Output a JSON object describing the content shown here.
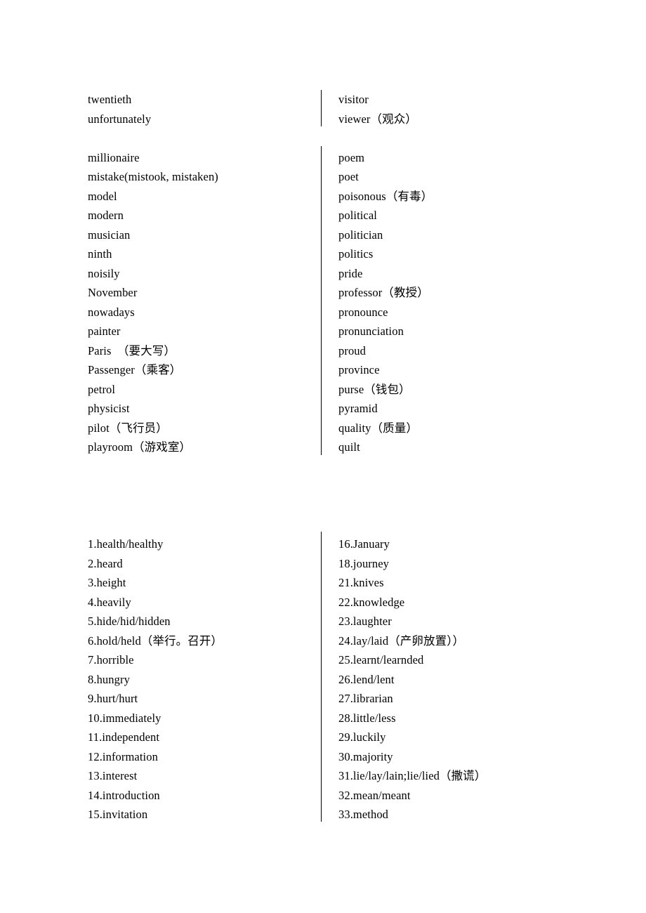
{
  "document": {
    "type": "vocabulary-word-list",
    "sections": [
      {
        "id": "words",
        "numbered": false,
        "left_column": {
          "blocks": [
            {
              "items": [
                "twentieth",
                "unfortunately"
              ]
            },
            {
              "items": [
                "millionaire",
                "mistake(mistook, mistaken)",
                "model",
                "modern",
                "musician",
                "ninth",
                "noisily",
                "November",
                "nowadays",
                "painter",
                "Paris  （要大写）",
                "Passenger（乘客）",
                "petrol",
                "physicist",
                "pilot（飞行员）",
                "playroom（游戏室）"
              ]
            }
          ]
        },
        "right_column": {
          "blocks": [
            {
              "items": [
                "visitor",
                "viewer（观众）"
              ]
            },
            {
              "items": [
                "poem",
                "poet",
                "poisonous（有毒）",
                "political",
                "politician",
                "politics",
                "pride",
                "professor（教授）",
                "pronounce",
                "pronunciation",
                "proud",
                "province",
                "purse（钱包）",
                "pyramid",
                "quality（质量）",
                "quilt"
              ]
            }
          ]
        }
      },
      {
        "id": "numbered",
        "numbered": true,
        "left_column": {
          "blocks": [
            {
              "items": [
                "1.health/healthy",
                "2.heard",
                "3.height",
                "4.heavily",
                "5.hide/hid/hidden",
                "6.hold/held（举行。召开）",
                "7.horrible",
                "8.hungry",
                "9.hurt/hurt",
                "10.immediately",
                "11.independent",
                "12.information",
                "13.interest",
                "14.introduction",
                "15.invitation"
              ]
            }
          ]
        },
        "right_column": {
          "blocks": [
            {
              "items": [
                "16.January",
                "18.journey",
                "21.knives",
                "22.knowledge",
                "23.laughter",
                "24.lay/laid（产卵放置））",
                "25.learnt/learnded",
                "26.lend/lent",
                "27.librarian",
                "28.little/less",
                "29.luckily",
                "30.majority",
                "31.lie/lay/lain;lie/lied（撒谎）",
                "32.mean/meant",
                "33.method"
              ]
            }
          ]
        }
      }
    ]
  }
}
